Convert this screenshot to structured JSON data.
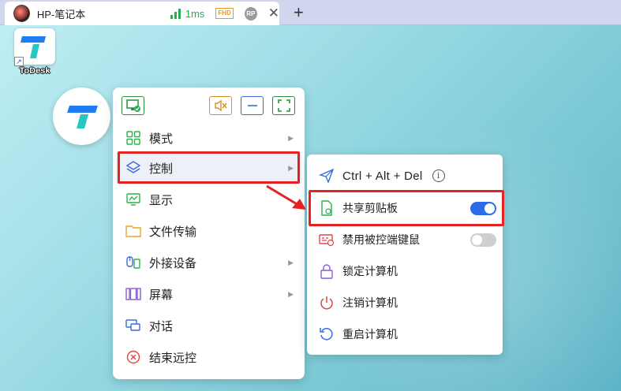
{
  "tab": {
    "title": "HP-笔记本",
    "latency": "1ms",
    "quality_badge": "FHD",
    "rp_badge": "RP",
    "close_icon": "close-icon",
    "new_tab_icon": "plus-icon"
  },
  "desktop": {
    "icon_label": "ToDesk"
  },
  "menu": {
    "toolbar": [
      "monitor-check-icon",
      "speaker-mute-icon",
      "minimize-icon",
      "fullscreen-icon"
    ],
    "items": [
      {
        "label": "模式",
        "icon": "grid-icon",
        "has_submenu": true
      },
      {
        "label": "控制",
        "icon": "layers-icon",
        "has_submenu": true,
        "active": true
      },
      {
        "label": "显示",
        "icon": "display-chart-icon",
        "has_submenu": false
      },
      {
        "label": "文件传输",
        "icon": "folder-icon",
        "has_submenu": false
      },
      {
        "label": "外接设备",
        "icon": "peripheral-icon",
        "has_submenu": true
      },
      {
        "label": "屏幕",
        "icon": "screen-icon",
        "has_submenu": true
      },
      {
        "label": "对话",
        "icon": "chat-icon",
        "has_submenu": false
      },
      {
        "label": "结束远控",
        "icon": "close-circle-icon",
        "has_submenu": false
      }
    ]
  },
  "submenu": {
    "items": [
      {
        "label": "Ctrl + Alt + Del",
        "icon": "send-icon",
        "info": "i"
      },
      {
        "label": "共享剪贴板",
        "icon": "clipboard-share-icon",
        "toggle": true,
        "on": true
      },
      {
        "label": "禁用被控端键鼠",
        "icon": "keyboard-disable-icon",
        "toggle": true,
        "on": false
      },
      {
        "label": "锁定计算机",
        "icon": "lock-icon"
      },
      {
        "label": "注销计算机",
        "icon": "power-icon"
      },
      {
        "label": "重启计算机",
        "icon": "restart-icon"
      }
    ]
  },
  "colors": {
    "accent_green": "#22b24c",
    "toggle_on": "#2d6ce8",
    "highlight_red": "#e52222",
    "brand_blue": "#1f7cf2"
  }
}
